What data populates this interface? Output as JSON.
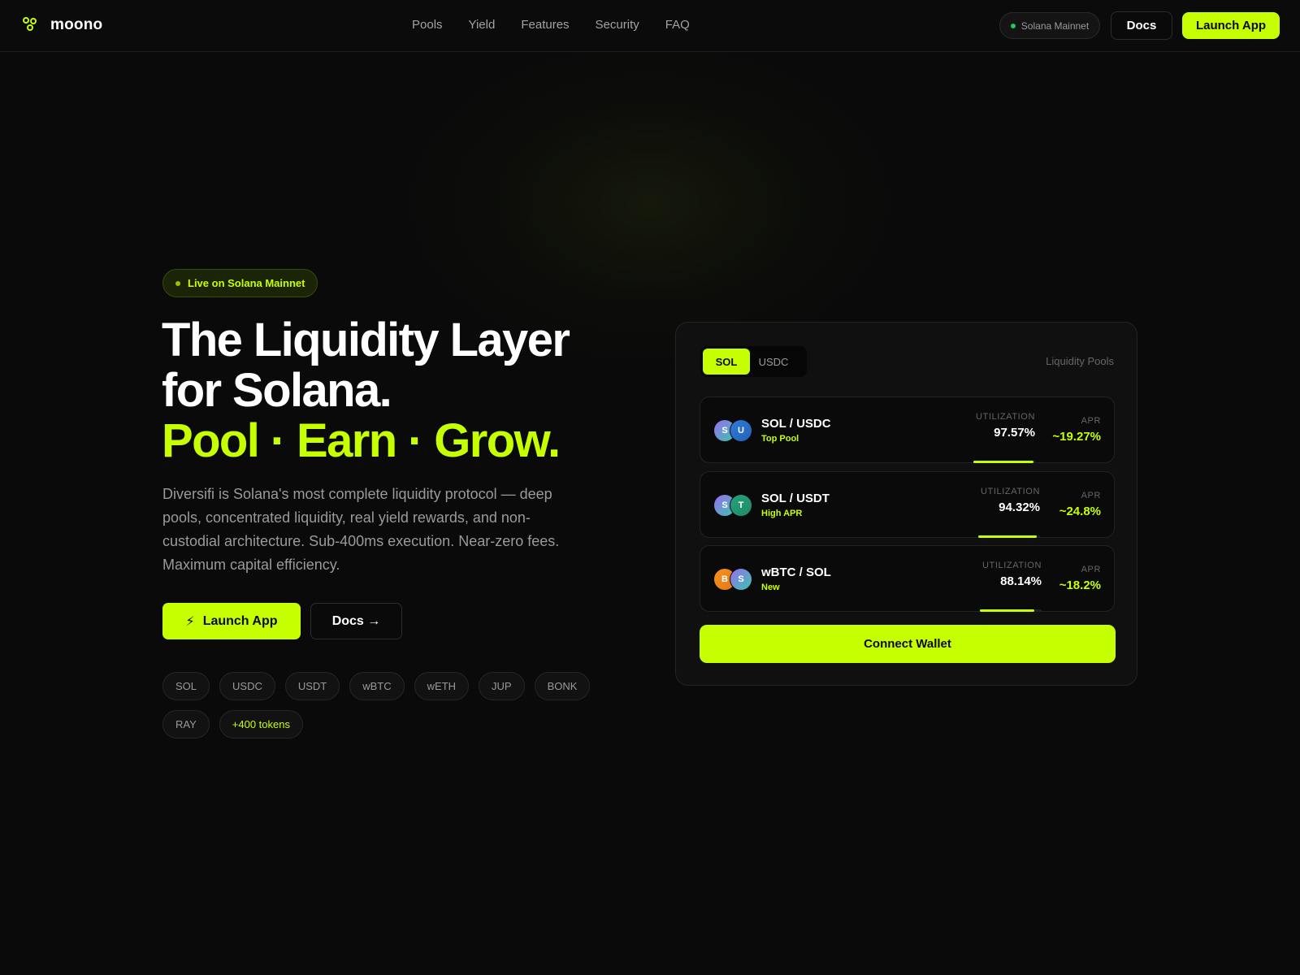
{
  "nav": {
    "logo_text": "moono",
    "links": [
      "Pools",
      "Yield",
      "Features",
      "Security",
      "FAQ"
    ],
    "network": "Solana Mainnet",
    "docs": "Docs",
    "launch": "Launch App"
  },
  "hero": {
    "badge": "Live on Solana Mainnet",
    "title_line1": "The Liquidity Layer",
    "title_line2": "for Solana.",
    "title_line3": "Pool · Earn · Grow.",
    "lead": "Diversifi is Solana's most complete liquidity protocol — deep pools, concentrated liquidity, real yield rewards, and non-custodial architecture. Sub-400ms execution. Near-zero fees. Maximum capital efficiency.",
    "cta_launch": "Launch App",
    "cta_launch_icon": "⚡",
    "cta_docs": "Docs →",
    "tokens": [
      "SOL",
      "USDC",
      "USDT",
      "wBTC",
      "wETH",
      "JUP",
      "BONK",
      "RAY"
    ],
    "tokens_more": "+400 tokens"
  },
  "card": {
    "tabs": [
      "SOL",
      "USDC"
    ],
    "active_tab": "SOL",
    "label": "Liquidity Pools",
    "util_label": "UTILIZATION",
    "apr_label": "APR",
    "pools": [
      {
        "name": "SOL / USDC",
        "tag": "Top Pool",
        "tok1": "S",
        "tok2": "U",
        "utilization": "97.57%",
        "util_fraction": 0.9757,
        "apr": "~19.27%"
      },
      {
        "name": "SOL / USDT",
        "tag": "High APR",
        "tok1": "S",
        "tok2": "T",
        "utilization": "94.32%",
        "util_fraction": 0.9432,
        "apr": "~24.8%"
      },
      {
        "name": "wBTC / SOL",
        "tag": "New",
        "tok1": "B",
        "tok2": "S",
        "utilization": "88.14%",
        "util_fraction": 0.8814,
        "apr": "~18.2%"
      }
    ],
    "connect": "Connect Wallet"
  },
  "colors": {
    "accent": "#c6ff00",
    "background": "#0a0a0a",
    "status_green": "#22c55e"
  },
  "icons": {
    "logo": "three-circles-icon",
    "launch": "lightning-icon"
  }
}
